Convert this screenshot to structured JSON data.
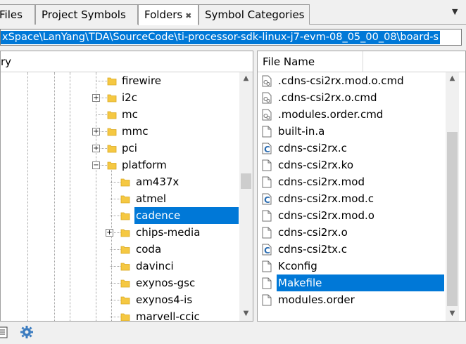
{
  "tabs": [
    {
      "label": "Files",
      "active": false
    },
    {
      "label": "Project Symbols",
      "active": false
    },
    {
      "label": "Folders",
      "active": true,
      "close": "✖"
    },
    {
      "label": "Symbol Categories",
      "active": false
    }
  ],
  "path": {
    "value": "xSpace\\LanYang\\TDA\\SourceCode\\ti-processor-sdk-linux-j7-evm-08_05_00_08\\board-s"
  },
  "left_pane": {
    "header": "ry",
    "items": [
      {
        "label": "firewire",
        "expander": ""
      },
      {
        "label": "i2c",
        "expander": "+"
      },
      {
        "label": "mc",
        "expander": ""
      },
      {
        "label": "mmc",
        "expander": "+"
      },
      {
        "label": "pci",
        "expander": "+"
      },
      {
        "label": "platform",
        "expander": "−"
      },
      {
        "label": "am437x",
        "expander": ""
      },
      {
        "label": "atmel",
        "expander": ""
      },
      {
        "label": "cadence",
        "expander": "",
        "selected": true
      },
      {
        "label": "chips-media",
        "expander": "+"
      },
      {
        "label": "coda",
        "expander": ""
      },
      {
        "label": "davinci",
        "expander": ""
      },
      {
        "label": "exynos-gsc",
        "expander": ""
      },
      {
        "label": "exynos4-is",
        "expander": ""
      },
      {
        "label": "marvell-ccic",
        "expander": ""
      }
    ]
  },
  "right_pane": {
    "header": "File Name",
    "files": [
      {
        "name": ".cdns-csi2rx.mod.o.cmd",
        "icon": "gear-file-icon"
      },
      {
        "name": ".cdns-csi2rx.o.cmd",
        "icon": "gear-file-icon"
      },
      {
        "name": ".modules.order.cmd",
        "icon": "gear-file-icon"
      },
      {
        "name": "built-in.a",
        "icon": "blank-file-icon"
      },
      {
        "name": "cdns-csi2rx.c",
        "icon": "c-file-icon"
      },
      {
        "name": "cdns-csi2rx.ko",
        "icon": "blank-file-icon"
      },
      {
        "name": "cdns-csi2rx.mod",
        "icon": "blank-file-icon"
      },
      {
        "name": "cdns-csi2rx.mod.c",
        "icon": "c-file-icon"
      },
      {
        "name": "cdns-csi2rx.mod.o",
        "icon": "blank-file-icon"
      },
      {
        "name": "cdns-csi2rx.o",
        "icon": "blank-file-icon"
      },
      {
        "name": "cdns-csi2tx.c",
        "icon": "c-file-icon"
      },
      {
        "name": "Kconfig",
        "icon": "blank-file-icon"
      },
      {
        "name": "Makefile",
        "icon": "blank-file-icon",
        "selected": true
      },
      {
        "name": "modules.order",
        "icon": "blank-file-icon"
      }
    ]
  },
  "toolbar": {
    "buttons": [
      "file-list-icon",
      "settings-gear-icon"
    ]
  },
  "colors": {
    "selection": "#0078d7",
    "folder": "#f5c842",
    "c_icon": "#2b6cb0"
  }
}
